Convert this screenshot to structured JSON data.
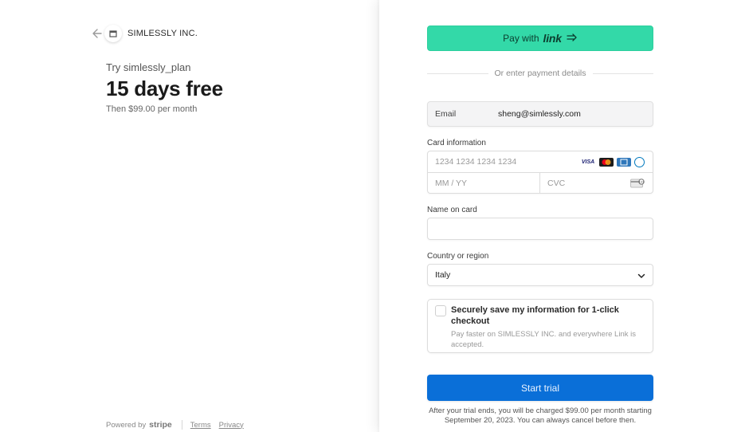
{
  "merchant": {
    "name": "SIMLESSLY INC.",
    "try_plan": "Try simlessly_plan",
    "trial_headline": "15 days free",
    "then_price": "Then $99.00 per month"
  },
  "footer": {
    "powered_by": "Powered by",
    "brand": "stripe",
    "terms": "Terms",
    "privacy": "Privacy"
  },
  "payment": {
    "link_button_prefix": "Pay with",
    "link_button_brand": "link",
    "or_text": "Or enter payment details",
    "email_label": "Email",
    "email_value": "sheng@simlessly.com",
    "card_label": "Card information",
    "card_number_placeholder": "1234 1234 1234 1234",
    "card_expiry_placeholder": "MM / YY",
    "card_cvc_placeholder": "CVC",
    "card_brands": [
      "VISA",
      "mastercard",
      "amex",
      "diners"
    ],
    "name_label": "Name on card",
    "name_value": "",
    "country_label": "Country or region",
    "country_value": "Italy",
    "save_title": "Securely save my information for 1-click checkout",
    "save_desc": "Pay faster on SIMLESSLY INC. and everywhere Link is accepted.",
    "save_checked": false,
    "start_button": "Start trial",
    "fine_print": "After your trial ends, you will be charged $99.00 per month starting September 20, 2023. You can always cancel before then."
  },
  "colors": {
    "link_green": "#33d9a8",
    "primary_blue": "#0a6fd8"
  }
}
